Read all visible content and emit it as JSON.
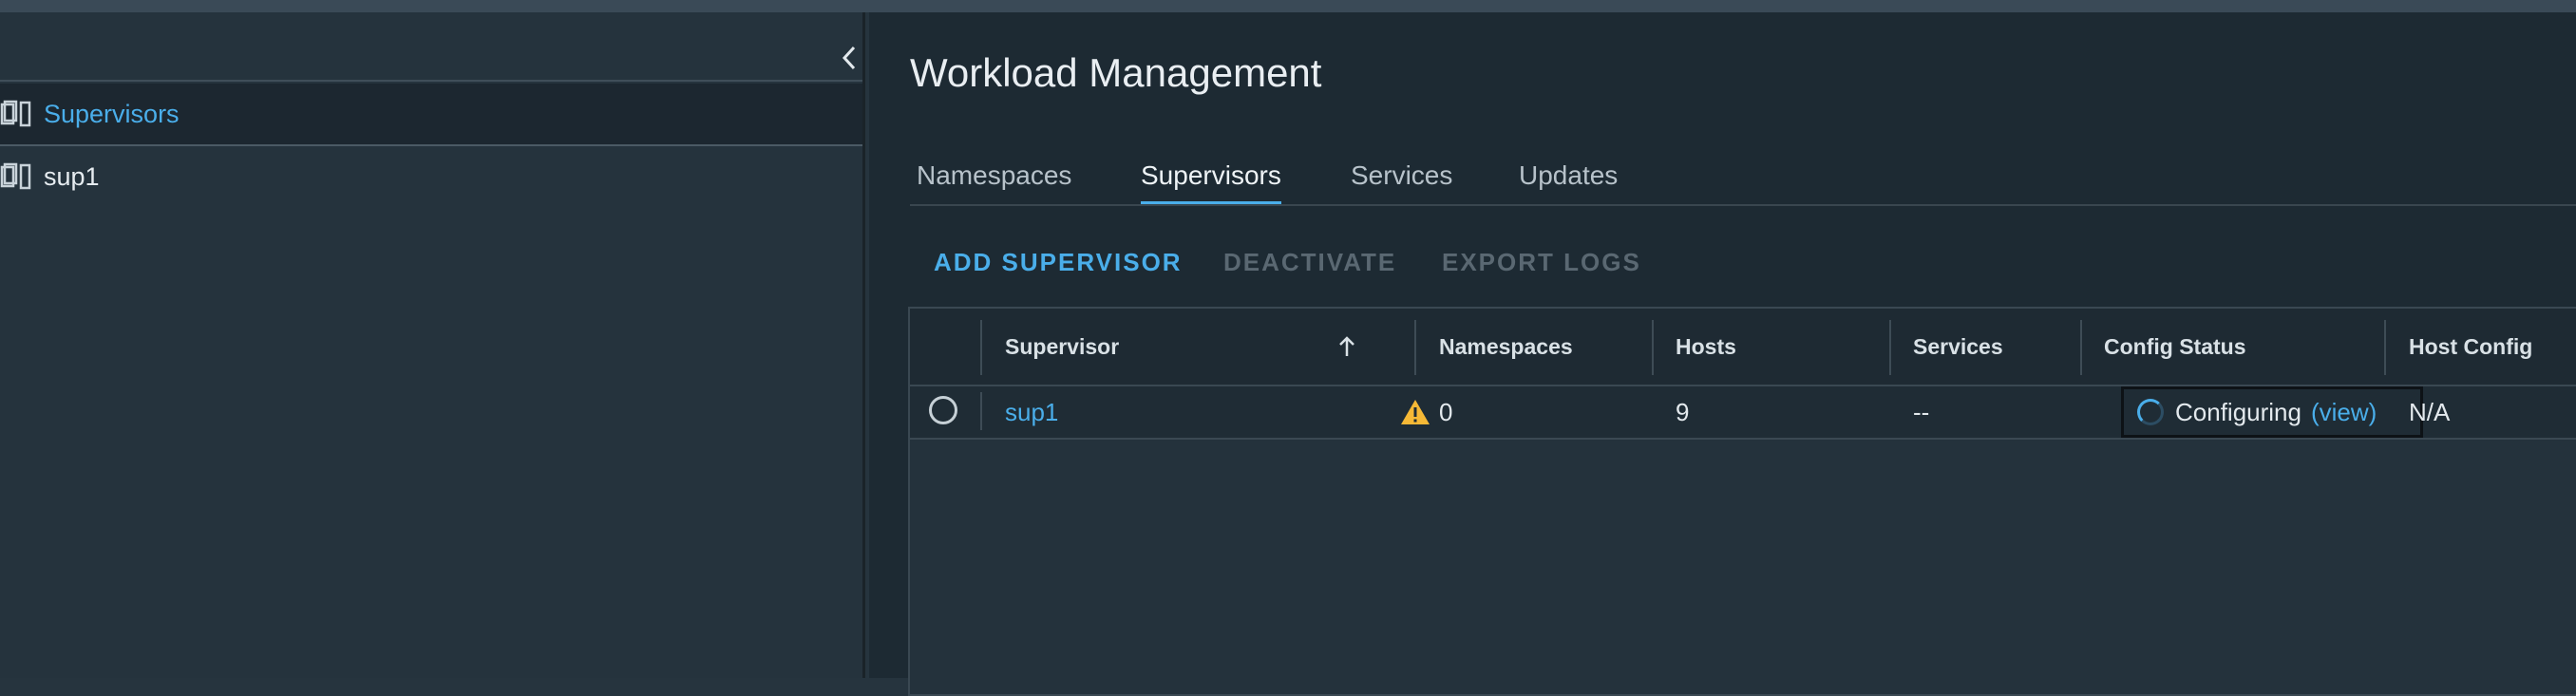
{
  "sidebar": {
    "collapse_icon": "chevron-left-icon",
    "items": [
      {
        "label": "Supervisors",
        "icon": "supervisor-cluster-icon",
        "active": true
      },
      {
        "label": "sup1",
        "icon": "supervisor-cluster-icon",
        "active": false
      }
    ]
  },
  "main": {
    "title": "Workload Management",
    "tabs": [
      {
        "label": "Namespaces",
        "active": false
      },
      {
        "label": "Supervisors",
        "active": true
      },
      {
        "label": "Services",
        "active": false
      },
      {
        "label": "Updates",
        "active": false
      }
    ],
    "actions": {
      "add": "ADD SUPERVISOR",
      "deactivate": "DEACTIVATE",
      "export": "EXPORT LOGS"
    },
    "grid": {
      "columns": [
        "Supervisor",
        "Namespaces",
        "Hosts",
        "Services",
        "Config Status",
        "Host Config"
      ],
      "sort_icon": "arrow-up-icon",
      "rows": [
        {
          "supervisor": "sup1",
          "warning_icon": "warning-triangle-icon",
          "namespaces": "0",
          "hosts": "9",
          "services": "--",
          "config_status": "Configuring",
          "config_status_link": "(view)",
          "host_config": "N/A"
        }
      ]
    }
  },
  "colors": {
    "accent": "#4aaeea",
    "warning": "#f6b936",
    "background": "#1d2a33",
    "sidebar": "#25333d"
  }
}
